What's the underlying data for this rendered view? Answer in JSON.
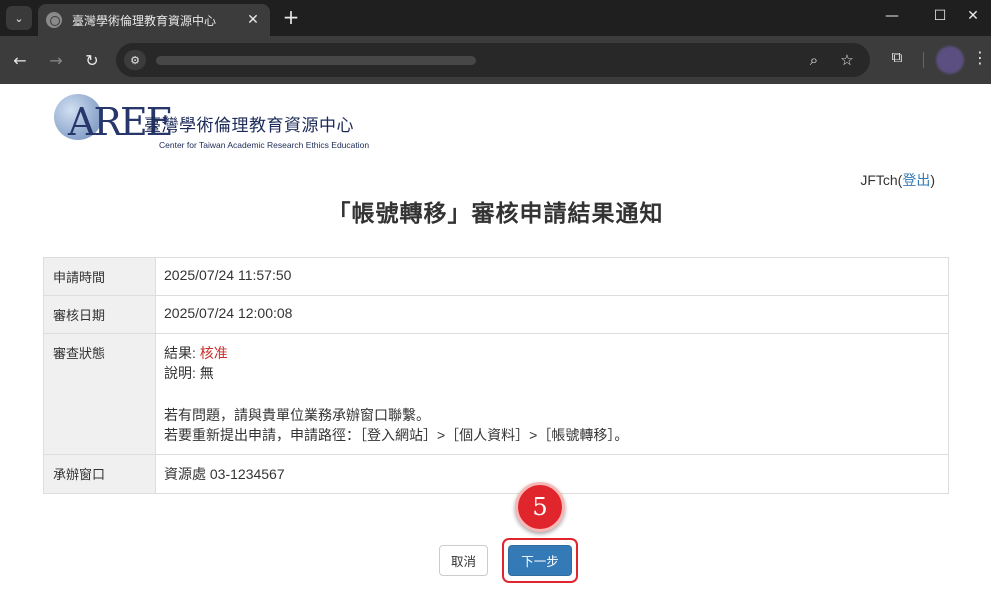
{
  "browser": {
    "tab_title": "臺灣學術倫理教育資源中心",
    "tab_close": "✕",
    "new_tab": "+",
    "window_minimize": "—",
    "window_maximize": "☐",
    "window_close": "✕",
    "back": "←",
    "forward": "→",
    "reload": "↻",
    "zoom_icon": "⌕",
    "bookmark_icon": "☆",
    "menu": "⋮"
  },
  "logo": {
    "mark": "AREE",
    "name_zh": "臺灣學術倫理教育資源中心",
    "name_en": "Center for Taiwan Academic Research Ethics Education"
  },
  "user": {
    "username": "JFTch",
    "logout_label": "登出"
  },
  "page_title": "「帳號轉移」審核申請結果通知",
  "details": {
    "rows": [
      {
        "label": "申請時間",
        "value": "2025/07/24 11:57:50"
      },
      {
        "label": "審核日期",
        "value": "2025/07/24 12:00:08"
      }
    ],
    "status": {
      "label": "審查狀態",
      "result_prefix": "結果: ",
      "result_value": "核准",
      "note_prefix": "說明: ",
      "note_value": "無",
      "help_line1": "若有問題，請與貴單位業務承辦窗口聯繫。",
      "help_line2": "若要重新提出申請，申請路徑：［登入網站］>［個人資料］>［帳號轉移］。"
    },
    "contact": {
      "label": "承辦窗口",
      "value": "資源處 03-1234567"
    }
  },
  "buttons": {
    "cancel": "取消",
    "next": "下一步"
  },
  "annotation": {
    "step_number": "5",
    "color": "#e0262c"
  }
}
